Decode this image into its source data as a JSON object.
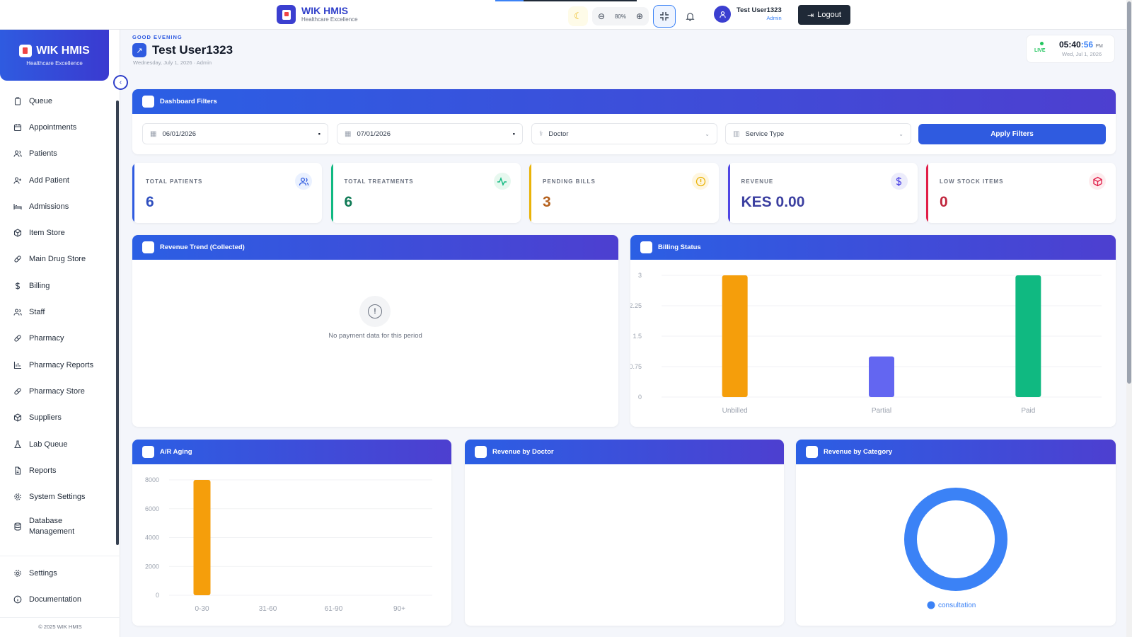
{
  "app": {
    "name": "WIK HMIS",
    "tagline": "Healthcare Excellence"
  },
  "topbar": {
    "zoom": "80%",
    "user_name": "Test User1323",
    "user_role": "Admin",
    "logout_label": "Logout"
  },
  "sidebar": {
    "items": [
      {
        "label": "Queue",
        "icon": "clipboard-icon"
      },
      {
        "label": "Appointments",
        "icon": "calendar-icon"
      },
      {
        "label": "Patients",
        "icon": "users-icon"
      },
      {
        "label": "Add Patient",
        "icon": "user-plus-icon"
      },
      {
        "label": "Admissions",
        "icon": "bed-icon"
      },
      {
        "label": "Item Store",
        "icon": "box-icon"
      },
      {
        "label": "Main Drug Store",
        "icon": "pill-icon"
      },
      {
        "label": "Billing",
        "icon": "dollar-icon"
      },
      {
        "label": "Staff",
        "icon": "users-icon"
      },
      {
        "label": "Pharmacy",
        "icon": "pill-icon"
      },
      {
        "label": "Pharmacy Reports",
        "icon": "bar-chart-icon"
      },
      {
        "label": "Pharmacy Store",
        "icon": "pill-icon"
      },
      {
        "label": "Suppliers",
        "icon": "box-icon"
      },
      {
        "label": "Lab Queue",
        "icon": "flask-icon"
      },
      {
        "label": "Reports",
        "icon": "file-icon"
      },
      {
        "label": "System Settings",
        "icon": "gear-icon"
      },
      {
        "label": "Database Management",
        "icon": "database-icon"
      }
    ],
    "bottom": [
      {
        "label": "Settings",
        "icon": "gear-icon"
      },
      {
        "label": "Documentation",
        "icon": "info-icon"
      }
    ],
    "copyright": "© 2025 WIK HMIS"
  },
  "header": {
    "greeting": "GOOD EVENING",
    "title": "Test User1323",
    "date": "Wednesday, July 1, 2026",
    "role": "Admin"
  },
  "clock": {
    "live": "LIVE",
    "hm": "05:40",
    "sec": ":56",
    "ampm": "PM",
    "date": "Wed, Jul 1, 2026"
  },
  "filters": {
    "title": "Dashboard Filters",
    "start_date": "06/01/2026",
    "end_date": "07/01/2026",
    "doctor": "Doctor",
    "service_type": "Service Type",
    "apply_label": "Apply Filters"
  },
  "stats": [
    {
      "label": "TOTAL PATIENTS",
      "value": "6",
      "color": "#2f4fbf",
      "icon": "users-icon"
    },
    {
      "label": "TOTAL TREATMENTS",
      "value": "6",
      "color": "#0f7a55",
      "icon": "activity-icon"
    },
    {
      "label": "PENDING BILLS",
      "value": "3",
      "color": "#b5611d",
      "icon": "alert-icon"
    },
    {
      "label": "REVENUE",
      "value": "KES 0.00",
      "color": "#3b3fa0",
      "icon": "dollar-icon"
    },
    {
      "label": "LOW STOCK ITEMS",
      "value": "0",
      "color": "#c0263d",
      "icon": "cube-icon"
    }
  ],
  "panels": {
    "revenue_trend": {
      "title": "Revenue Trend (Collected)",
      "empty_message": "No payment data for this period"
    },
    "billing_status": {
      "title": "Billing Status"
    },
    "ar_aging": {
      "title": "A/R Aging"
    },
    "revenue_doctor": {
      "title": "Revenue by Doctor"
    },
    "revenue_category": {
      "title": "Revenue by Category"
    }
  },
  "chart_data": [
    {
      "type": "bar",
      "title": "Billing Status",
      "categories": [
        "Unbilled",
        "Partial",
        "Paid"
      ],
      "values": [
        3,
        1,
        3
      ],
      "colors": [
        "#f59e0b",
        "#6366f1",
        "#10b981"
      ],
      "ylim": [
        0,
        3
      ],
      "yticks": [
        "3",
        "2.25",
        "1.5",
        "0.75",
        "0"
      ]
    },
    {
      "type": "bar",
      "title": "A/R Aging",
      "categories": [
        "0-30",
        "31-60",
        "61-90",
        "90+"
      ],
      "values": [
        8000,
        0,
        0,
        0
      ],
      "colors": [
        "#f59e0b"
      ],
      "ylim": [
        0,
        8000
      ],
      "yticks": [
        "8000",
        "6000",
        "4000",
        "2000",
        "0"
      ]
    },
    {
      "type": "pie",
      "title": "Revenue by Category",
      "labels": [
        "consultation"
      ],
      "values": [
        1
      ],
      "colors": [
        "#3b82f6"
      ]
    }
  ]
}
